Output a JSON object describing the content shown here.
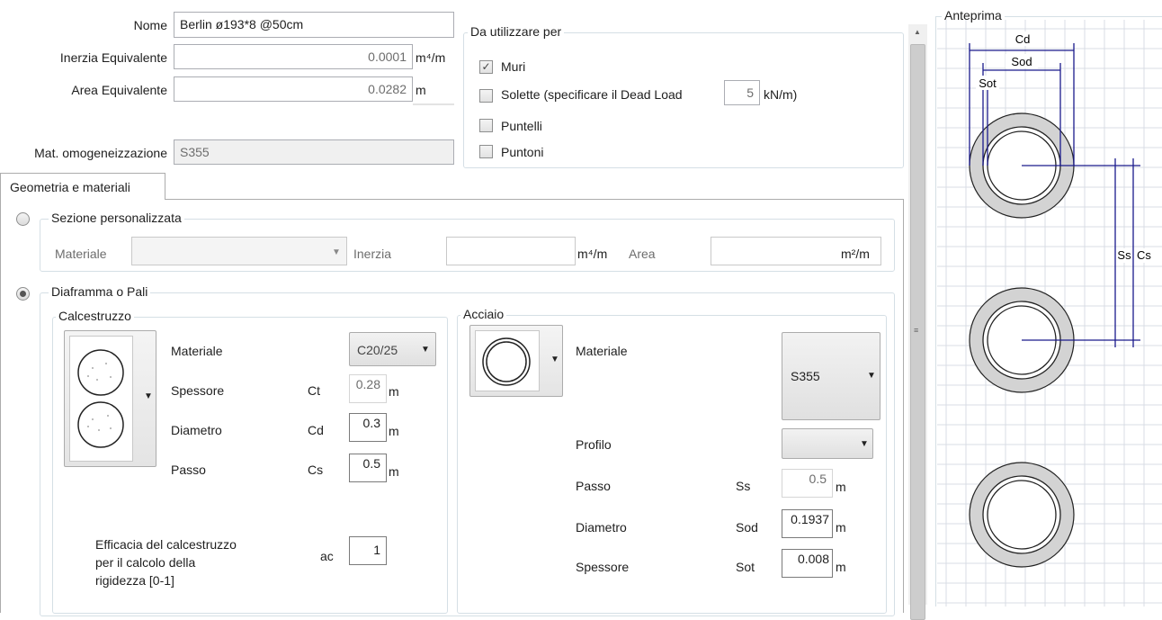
{
  "form": {
    "nome": {
      "label": "Nome",
      "value": "Berlin ø193*8 @50cm"
    },
    "inerzia": {
      "label": "Inerzia Equivalente",
      "value": "0.0001",
      "unit": "m⁴/m"
    },
    "area": {
      "label": "Area Equivalente",
      "value": "0.0282",
      "unit": "m"
    },
    "mat_omog": {
      "label": "Mat. omogeneizzazione",
      "value": "S355"
    }
  },
  "usage": {
    "title": "Da utilizzare per",
    "muri": {
      "label": "Muri",
      "checked": true
    },
    "solette": {
      "label": "Solette  (specificare il Dead Load",
      "value": "5",
      "unit": "kN/m)"
    },
    "puntelli": {
      "label": "Puntelli"
    },
    "puntoni": {
      "label": "Puntoni"
    }
  },
  "tab": {
    "label": "Geometria e materiali"
  },
  "custom_section": {
    "title": "Sezione personalizzata",
    "materiale_label": "Materiale",
    "materiale_value": "",
    "inerzia_label": "Inerzia",
    "inerzia_unit": "m⁴/m",
    "area_label": "Area",
    "area_unit": "m²/m"
  },
  "pile_section": {
    "title": "Diaframma o Pali",
    "concrete": {
      "title": "Calcestruzzo",
      "materiale": {
        "label": "Materiale",
        "value": "C20/25"
      },
      "spessore": {
        "label": "Spessore",
        "sym": "Ct",
        "value": "0.28",
        "unit": "m"
      },
      "diametro": {
        "label": "Diametro",
        "sym": "Cd",
        "value": "0.3",
        "unit": "m"
      },
      "passo": {
        "label": "Passo",
        "sym": "Cs",
        "value": "0.5",
        "unit": "m"
      },
      "efficacia": {
        "line1": "Efficacia del calcestruzzo",
        "line2": "per il calcolo della",
        "line3": "rigidezza  [0-1]",
        "sym": "ac",
        "value": "1"
      }
    },
    "steel": {
      "title": "Acciaio",
      "materiale": {
        "label": "Materiale",
        "value": "S355"
      },
      "profilo": {
        "label": "Profilo",
        "value": ""
      },
      "passo": {
        "label": "Passo",
        "sym": "Ss",
        "value": "0.5",
        "unit": "m"
      },
      "diametro": {
        "label": "Diametro",
        "sym": "Sod",
        "value": "0.1937",
        "unit": "m"
      },
      "spessore": {
        "label": "Spessore",
        "sym": "Sot",
        "value": "0.008",
        "unit": "m"
      }
    }
  },
  "preview": {
    "title": "Anteprima",
    "labels": {
      "cd": "Cd",
      "sod": "Sod",
      "sot": "Sot",
      "ss": "Ss",
      "cs": "Cs"
    }
  },
  "colors": {
    "dimension_line": "#1a1a8c",
    "circle_fill": "#d3d3d3",
    "grid": "#d8dce4"
  }
}
